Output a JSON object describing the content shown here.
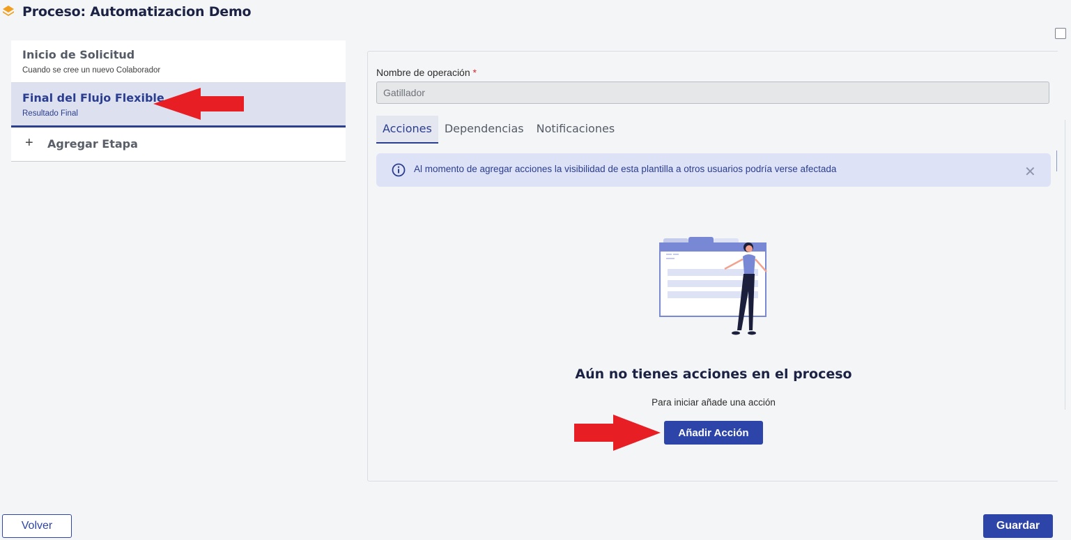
{
  "header": {
    "title": "Proceso: Automatizacion Demo",
    "icon": "layers-icon",
    "icon_color": "#f0a020"
  },
  "stages": [
    {
      "title": "Inicio de Solicitud",
      "subtitle": "Cuando se cree un nuevo Colaborador"
    },
    {
      "title": "Final del Flujo Flexible",
      "subtitle": "Resultado Final"
    }
  ],
  "add_stage": {
    "icon": "plus-icon",
    "label": "Agregar Etapa"
  },
  "form": {
    "label": "Nombre de operación",
    "required_mark": "*",
    "value": "Gatillador"
  },
  "tabs": [
    {
      "label": "Acciones",
      "active": true
    },
    {
      "label": "Dependencias",
      "active": false
    },
    {
      "label": "Notificaciones",
      "active": false
    }
  ],
  "alert": {
    "icon": "info-icon",
    "message": "Al momento de agregar acciones la visibilidad de esta plantilla a otros usuarios podría verse afectada",
    "close_icon": "close-icon"
  },
  "empty_state": {
    "title": "Aún no tienes acciones en el proceso",
    "subtitle": "Para iniciar añade una acción",
    "button": "Añadir Acción"
  },
  "footer": {
    "back": "Volver",
    "save": "Guardar"
  },
  "colors": {
    "primary": "#2d44a8",
    "active_stage_bg": "#dde0ee",
    "alert_bg": "#dde2f7",
    "annotation_arrow": "#e81e25"
  }
}
